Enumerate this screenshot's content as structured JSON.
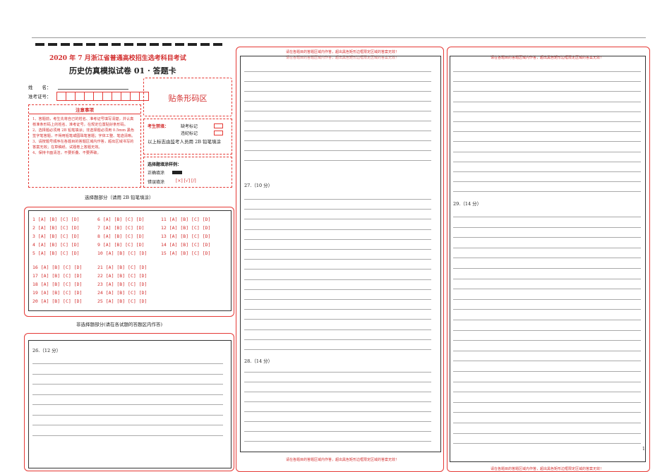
{
  "header": {
    "title_line1": "2020 年 7 月浙江省普通高校招生选考科目考试",
    "title_line2": "历史仿真模拟试卷 01 · 答题卡",
    "name_label": "姓　　名：",
    "exam_no_label": "准考证号："
  },
  "barcode_label": "贴条形码区",
  "notice": {
    "title": "注意事项",
    "items": [
      "1、答题前，考生先将自己的姓名、准考证号填写清楚，并认真核准条形码上的姓名、准考证号，在规定位置贴好条形码。",
      "2、选择题必须用 2B 铅笔填涂；非选择题必须用 0.5mm 黑色签字笔答题，不得用铅笔或圆珠笔答题；字体工整、笔迹清晰。",
      "3、请按题号顺序在各题目的答题区域内作答，超出区域书写的答案无效；在草稿纸、试题卷上答题无效。",
      "4、保持卡面清洁，不要折叠、不要弄破。"
    ]
  },
  "absent": {
    "label": "考生禁填：",
    "missing": "缺考标记",
    "violation": "违纪标记",
    "note": "以上标志由监考人员用 2B 铅笔填涂"
  },
  "example": {
    "title": "选择题填涂样例：",
    "correct": "正确填涂",
    "wrong": "错误填涂",
    "wrong_marks": "[×] [√] [/]"
  },
  "choice_section_title": "选择题部分（请用 2B 铅笔填涂）",
  "choice_rows": [
    [
      "1 [A] [B] [C] [D]",
      "6 [A] [B] [C] [D]",
      "11 [A] [B] [C] [D]"
    ],
    [
      "2 [A] [B] [C] [D]",
      "7 [A] [B] [C] [D]",
      "12 [A] [B] [C] [D]"
    ],
    [
      "3 [A] [B] [C] [D]",
      "8 [A] [B] [C] [D]",
      "13 [A] [B] [C] [D]"
    ],
    [
      "4 [A] [B] [C] [D]",
      "9 [A] [B] [C] [D]",
      "14 [A] [B] [C] [D]"
    ],
    [
      "5 [A] [B] [C] [D]",
      "10 [A] [B] [C] [D]",
      "15 [A] [B] [C] [D]"
    ],
    [
      "16 [A] [B] [C] [D]",
      "21 [A] [B] [C] [D]",
      ""
    ],
    [
      "17 [A] [B] [C] [D]",
      "22 [A] [B] [C] [D]",
      ""
    ],
    [
      "18 [A] [B] [C] [D]",
      "23 [A] [B] [C] [D]",
      ""
    ],
    [
      "19 [A] [B] [C] [D]",
      "24 [A] [B] [C] [D]",
      ""
    ],
    [
      "20 [A] [B] [C] [D]",
      "25 [A] [B] [C] [D]",
      ""
    ]
  ],
  "nonchoice_section_title": "非选择题部分(请在各试题的答题区内作答)",
  "q26": "26.（12 分）",
  "q27": "27.（10 分）",
  "q28": "28.（14 分）",
  "q29": "29.（14 分）",
  "area_warning": "请在各题目的答题区域内作答，超出黑色矩形边框限定区域的答案无效！",
  "page_number": "1"
}
